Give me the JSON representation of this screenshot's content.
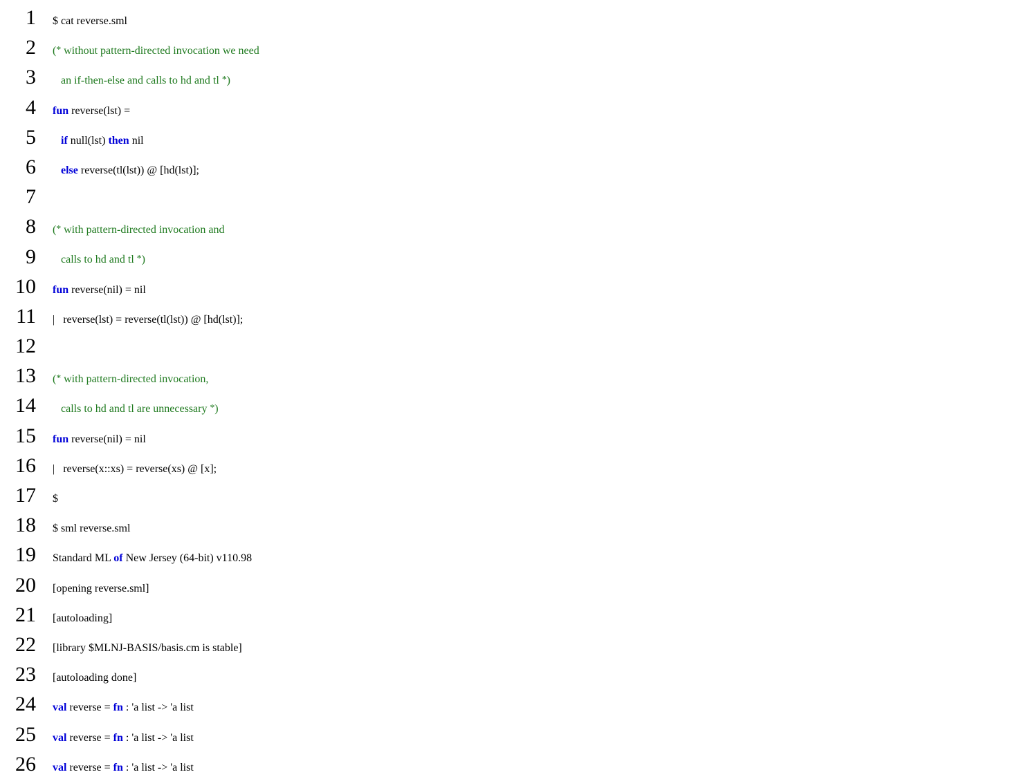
{
  "lines": [
    {
      "n": "1",
      "tokens": [
        {
          "t": "$ cat reverse.sml"
        }
      ]
    },
    {
      "n": "2",
      "tokens": [
        {
          "t": "(",
          "c": "cm"
        },
        {
          "t": "*",
          "c": "cm star"
        },
        {
          "t": " without pattern-directed invocation we need",
          "c": "cm"
        }
      ]
    },
    {
      "n": "3",
      "tokens": [
        {
          "t": "   an if-then-else and calls to hd and tl ",
          "c": "cm"
        },
        {
          "t": "*",
          "c": "cm star"
        },
        {
          "t": ")",
          "c": "cm"
        }
      ]
    },
    {
      "n": "4",
      "tokens": [
        {
          "t": "fun",
          "c": "kw"
        },
        {
          "t": " reverse(lst) ="
        }
      ]
    },
    {
      "n": "5",
      "tokens": [
        {
          "t": "   "
        },
        {
          "t": "if",
          "c": "kw"
        },
        {
          "t": " null(lst) "
        },
        {
          "t": "then",
          "c": "kw"
        },
        {
          "t": " nil"
        }
      ]
    },
    {
      "n": "6",
      "tokens": [
        {
          "t": "   "
        },
        {
          "t": "else",
          "c": "kw"
        },
        {
          "t": " reverse(tl(lst)) @ [hd(lst)];"
        }
      ]
    },
    {
      "n": "7",
      "tokens": [
        {
          "t": " "
        }
      ]
    },
    {
      "n": "8",
      "tokens": [
        {
          "t": "(",
          "c": "cm"
        },
        {
          "t": "*",
          "c": "cm star"
        },
        {
          "t": " with pattern-directed invocation and",
          "c": "cm"
        }
      ]
    },
    {
      "n": "9",
      "tokens": [
        {
          "t": "   calls to hd and tl ",
          "c": "cm"
        },
        {
          "t": "*",
          "c": "cm star"
        },
        {
          "t": ")",
          "c": "cm"
        }
      ]
    },
    {
      "n": "10",
      "tokens": [
        {
          "t": "fun",
          "c": "kw"
        },
        {
          "t": " reverse(nil) = nil"
        }
      ]
    },
    {
      "n": "11",
      "tokens": [
        {
          "t": "|   reverse(lst) = reverse(tl(lst)) @ [hd(lst)];"
        }
      ]
    },
    {
      "n": "12",
      "tokens": [
        {
          "t": " "
        }
      ]
    },
    {
      "n": "13",
      "tokens": [
        {
          "t": "(",
          "c": "cm"
        },
        {
          "t": "*",
          "c": "cm star"
        },
        {
          "t": " with pattern-directed invocation,",
          "c": "cm"
        }
      ]
    },
    {
      "n": "14",
      "tokens": [
        {
          "t": "   calls to hd and tl are unnecessary ",
          "c": "cm"
        },
        {
          "t": "*",
          "c": "cm star"
        },
        {
          "t": ")",
          "c": "cm"
        }
      ]
    },
    {
      "n": "15",
      "tokens": [
        {
          "t": "fun",
          "c": "kw"
        },
        {
          "t": " reverse(nil) = nil"
        }
      ]
    },
    {
      "n": "16",
      "tokens": [
        {
          "t": "|   reverse(x::xs) = reverse(xs) @ [x];"
        }
      ]
    },
    {
      "n": "17",
      "tokens": [
        {
          "t": "$"
        }
      ]
    },
    {
      "n": "18",
      "tokens": [
        {
          "t": "$ sml reverse.sml"
        }
      ]
    },
    {
      "n": "19",
      "tokens": [
        {
          "t": "Standard ML "
        },
        {
          "t": "of",
          "c": "kw"
        },
        {
          "t": " New Jersey (64-bit) v110.98"
        }
      ]
    },
    {
      "n": "20",
      "tokens": [
        {
          "t": "[opening reverse.sml]"
        }
      ]
    },
    {
      "n": "21",
      "tokens": [
        {
          "t": "[autoloading]"
        }
      ]
    },
    {
      "n": "22",
      "tokens": [
        {
          "t": "[library $MLNJ-BASIS/basis.cm is stable]"
        }
      ]
    },
    {
      "n": "23",
      "tokens": [
        {
          "t": "[autoloading done]"
        }
      ]
    },
    {
      "n": "24",
      "tokens": [
        {
          "t": "val",
          "c": "kw"
        },
        {
          "t": " reverse = "
        },
        {
          "t": "fn",
          "c": "kw"
        },
        {
          "t": " : 'a list -> 'a list"
        }
      ]
    },
    {
      "n": "25",
      "tokens": [
        {
          "t": "val",
          "c": "kw"
        },
        {
          "t": " reverse = "
        },
        {
          "t": "fn",
          "c": "kw"
        },
        {
          "t": " : 'a list -> 'a list"
        }
      ]
    },
    {
      "n": "26",
      "tokens": [
        {
          "t": "val",
          "c": "kw"
        },
        {
          "t": " reverse = "
        },
        {
          "t": "fn",
          "c": "kw"
        },
        {
          "t": " : 'a list -> 'a list"
        }
      ]
    }
  ]
}
